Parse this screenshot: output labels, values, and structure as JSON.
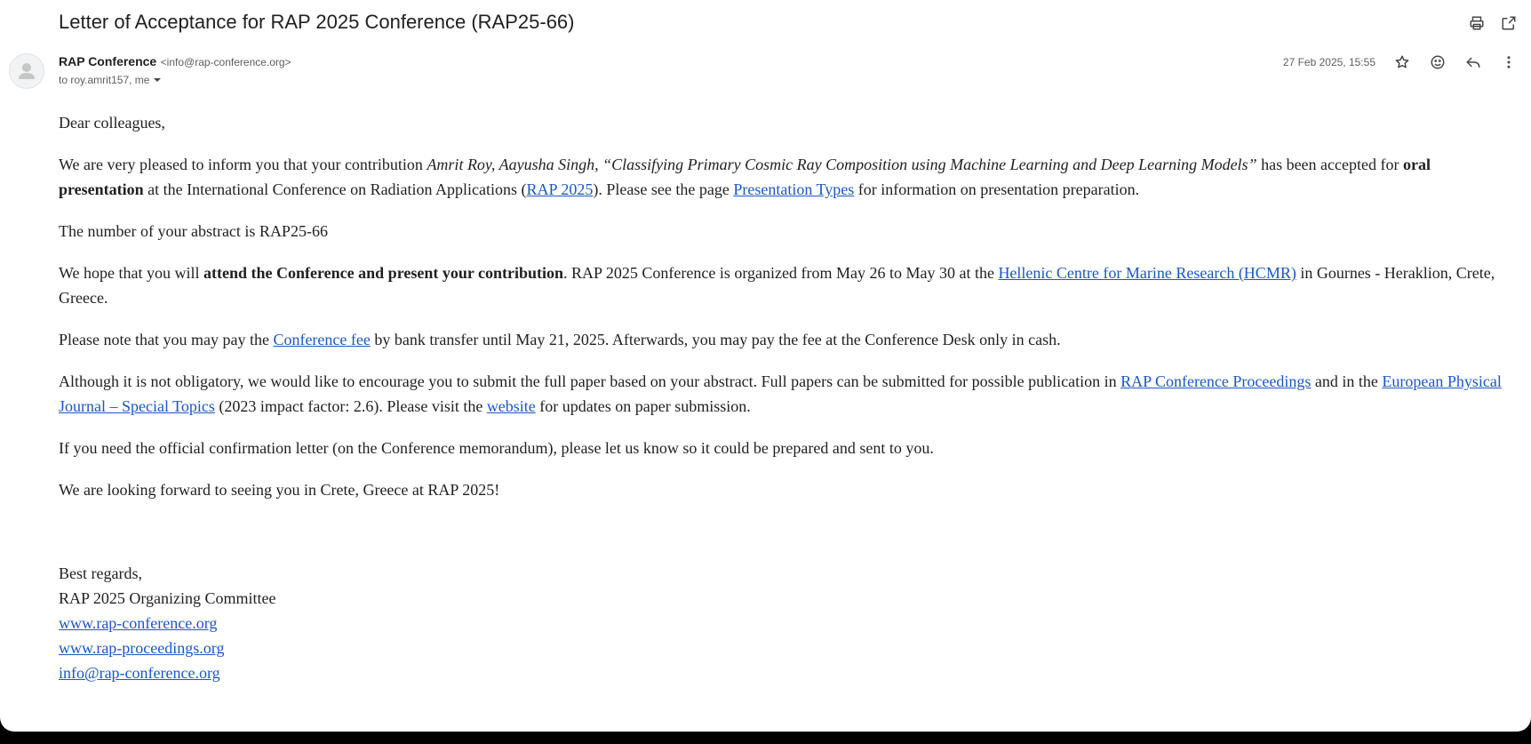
{
  "email": {
    "subject": "Letter of Acceptance for RAP 2025 Conference (RAP25-66)",
    "sender_name": "RAP Conference",
    "sender_email": "<info@rap-conference.org>",
    "recipients": "to roy.amrit157, me",
    "date": "27 Feb 2025, 15:55"
  },
  "icons": {
    "print": "print-icon",
    "popout": "open-in-new-window-icon",
    "star": "star-icon",
    "emoji": "emoji-reaction-icon",
    "reply": "reply-icon",
    "more": "more-vertical-icon",
    "avatar": "default-avatar-person-icon",
    "dropdown": "caret-down-icon"
  },
  "colors": {
    "link": "#1a57c8",
    "text": "#1f1f1f",
    "muted": "#5e5e5e"
  },
  "body": {
    "greeting": "Dear colleagues,",
    "p1": {
      "pre": "We are very pleased to inform you that your contribution ",
      "italic": "Amrit Roy, Aayusha Singh, “Classifying Primary Cosmic Ray Composition using Machine Learning and Deep Learning Models”",
      "mid": " has been accepted for ",
      "bold": "oral presentation",
      "mid2": " at the International Conference on Radiation Applications (",
      "link1": "RAP 2025",
      "mid3": "). Please see the page ",
      "link2": "Presentation Types",
      "post": " for information on presentation preparation."
    },
    "p2": "The number of your abstract is RAP25-66",
    "p3": {
      "pre": "We hope that you will ",
      "bold": "attend the Conference and present your contribution",
      "mid": ". RAP 2025 Conference is organized from May 26 to May 30 at the ",
      "link": "Hellenic Centre for Marine Research (HCMR)",
      "post": " in Gournes - Heraklion, Crete, Greece."
    },
    "p4": {
      "pre": "Please note that you may pay the ",
      "link": "Conference fee",
      "post": " by bank transfer until May 21, 2025. Afterwards, you may pay the fee at the Conference Desk only in cash."
    },
    "p5": {
      "pre": "Although it is not obligatory, we would like to encourage you to submit the full paper based on your abstract. Full papers can be submitted for possible publication in ",
      "link1": "RAP Conference Proceedings",
      "mid": " and in the ",
      "link2": "European Physical Journal – Special Topics",
      "mid2": " (2023 impact factor: 2.6). Please visit the ",
      "link3": "website",
      "post": " for updates on paper submission."
    },
    "p6": "If you need the official confirmation letter (on the Conference memorandum), please let us know so it could be prepared and sent to you.",
    "p7": "We are looking forward to seeing you in Crete, Greece at RAP 2025!",
    "signature": {
      "closing": "Best regards,",
      "org": "RAP 2025 Organizing Committee",
      "site1": "www.rap-conference.org",
      "site2": "www.rap-proceedings.org",
      "email": "info@rap-conference.org"
    }
  }
}
